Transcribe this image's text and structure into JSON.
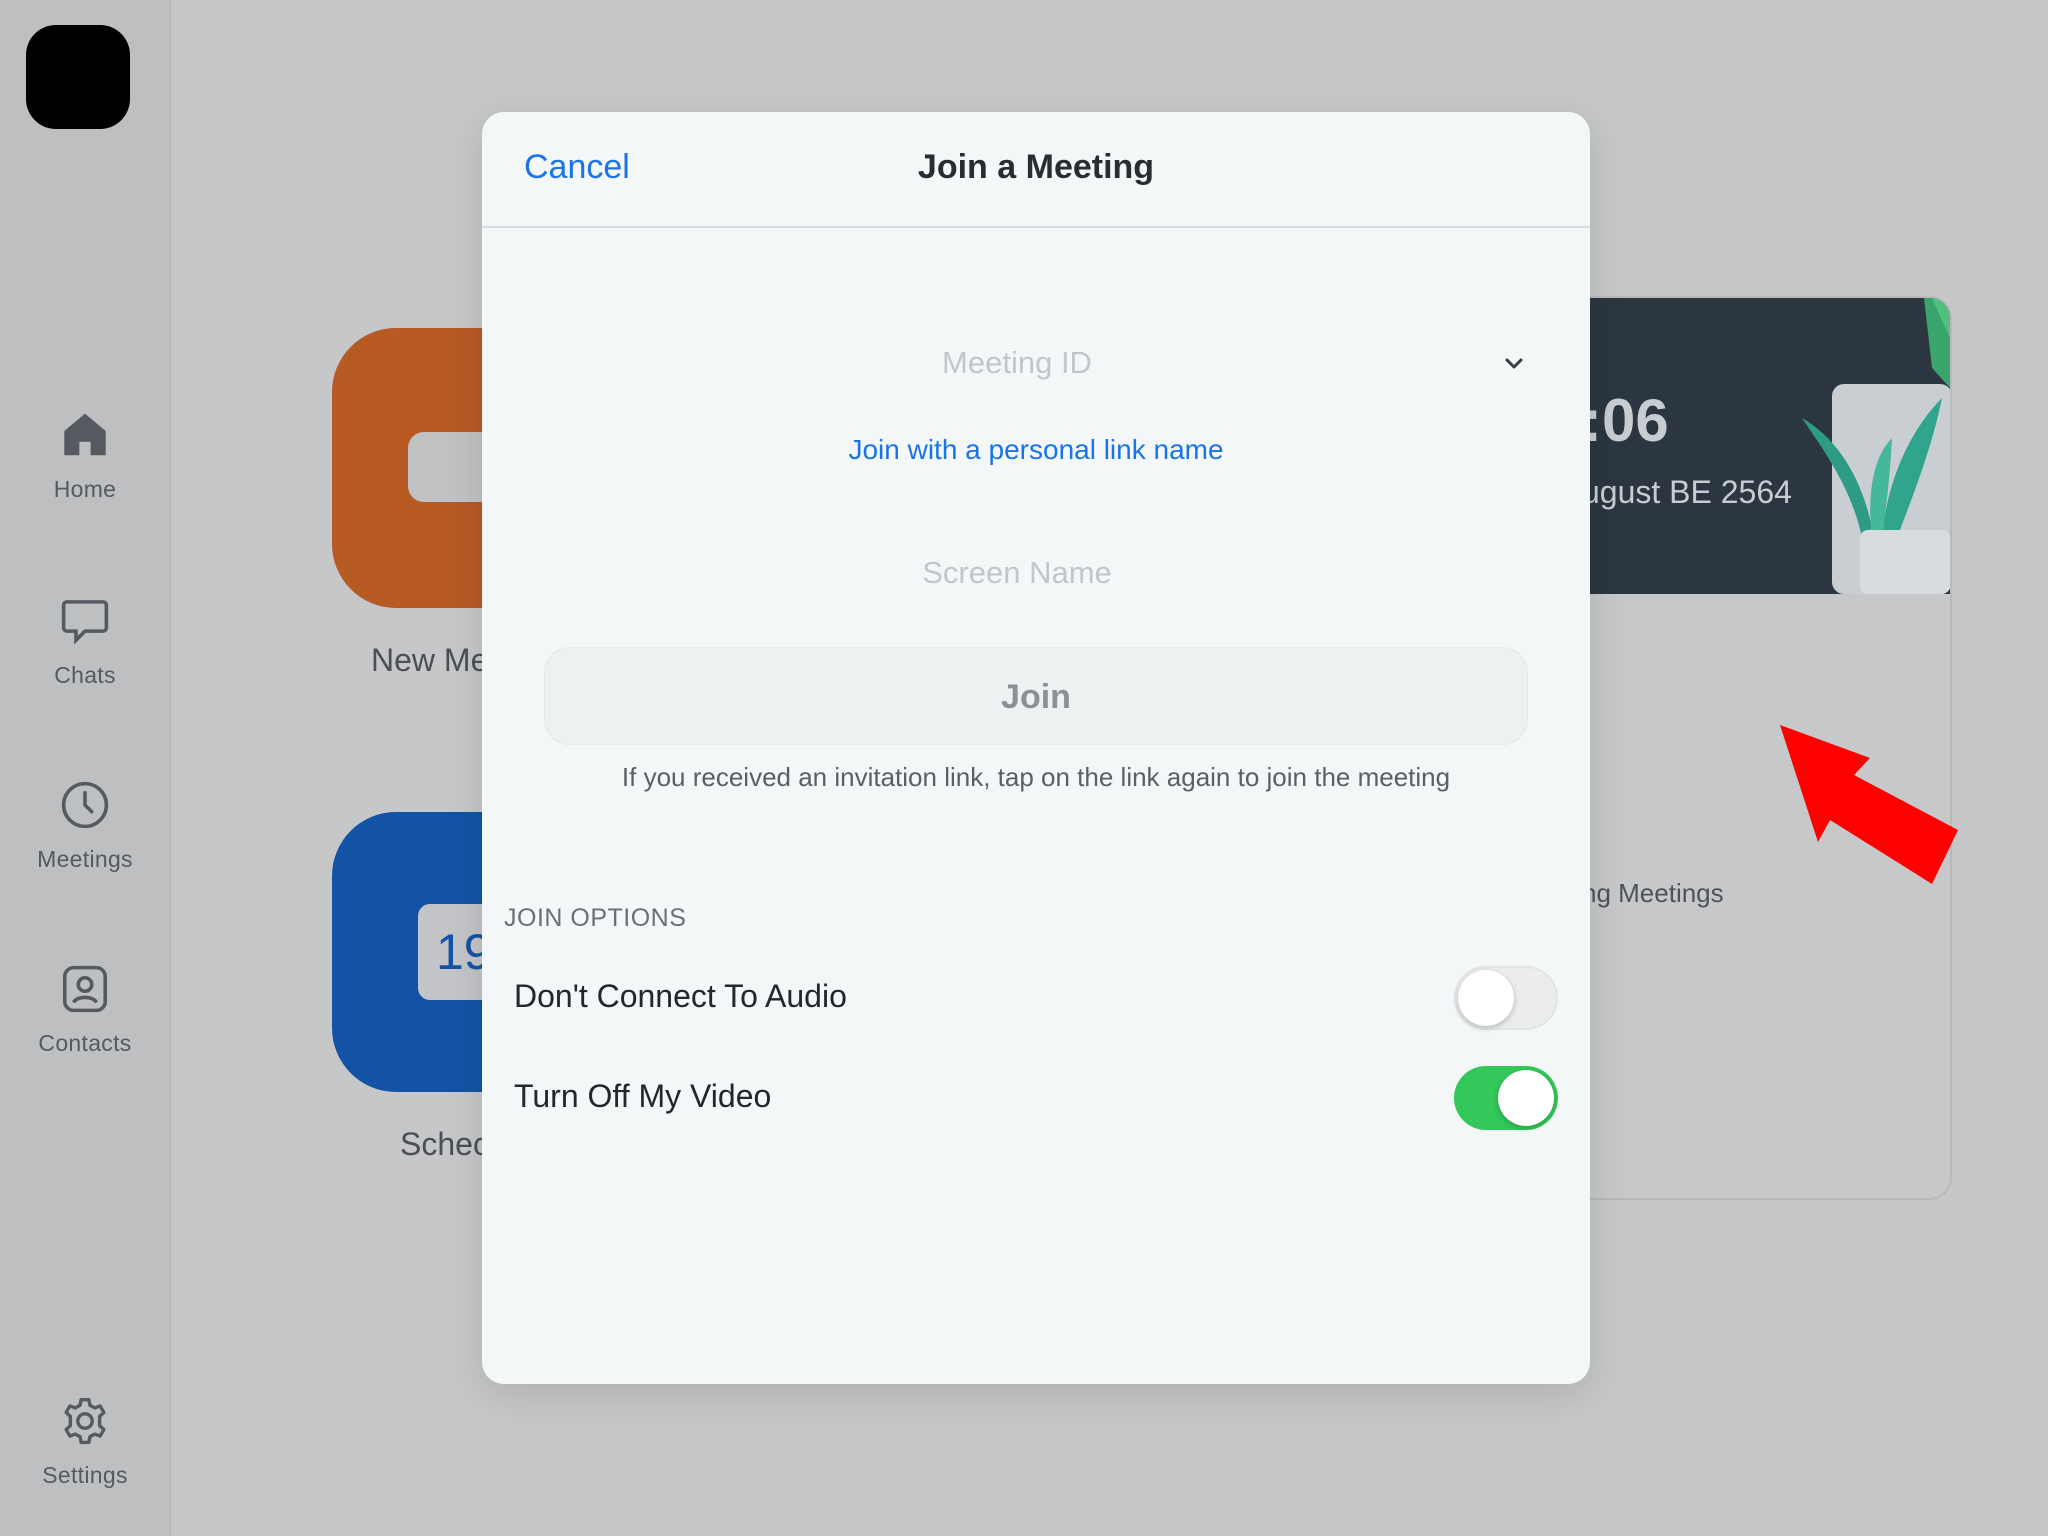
{
  "sidebar": {
    "items": [
      {
        "label": "Home",
        "icon": "home-icon"
      },
      {
        "label": "Chats",
        "icon": "chat-bubble-icon"
      },
      {
        "label": "Meetings",
        "icon": "clock-icon"
      },
      {
        "label": "Contacts",
        "icon": "contact-card-icon"
      },
      {
        "label": "Settings",
        "icon": "gear-icon"
      }
    ]
  },
  "background": {
    "new_meeting_label": "New Me",
    "schedule_label": "Schec",
    "calendar_day": "19",
    "clock_time": ":06",
    "clock_date": "ugust BE 2564",
    "upcoming_label": "ng Meetings"
  },
  "modal": {
    "cancel_label": "Cancel",
    "title": "Join a Meeting",
    "meeting_id_placeholder": "Meeting ID",
    "personal_link_label": "Join with a personal link name",
    "screen_name_placeholder": "Screen Name",
    "join_label": "Join",
    "invite_hint": "If you received an invitation link, tap on the link again to join the meeting",
    "join_options_heading": "JOIN OPTIONS",
    "options": [
      {
        "label": "Don't Connect To Audio",
        "enabled": false
      },
      {
        "label": "Turn Off My Video",
        "enabled": true
      }
    ]
  },
  "colors": {
    "accent": "#1a73e8",
    "toggle_on": "#34c759",
    "new_meeting_tile": "#b75a24",
    "schedule_tile": "#1353a6",
    "annotation_arrow": "#ff0000"
  }
}
